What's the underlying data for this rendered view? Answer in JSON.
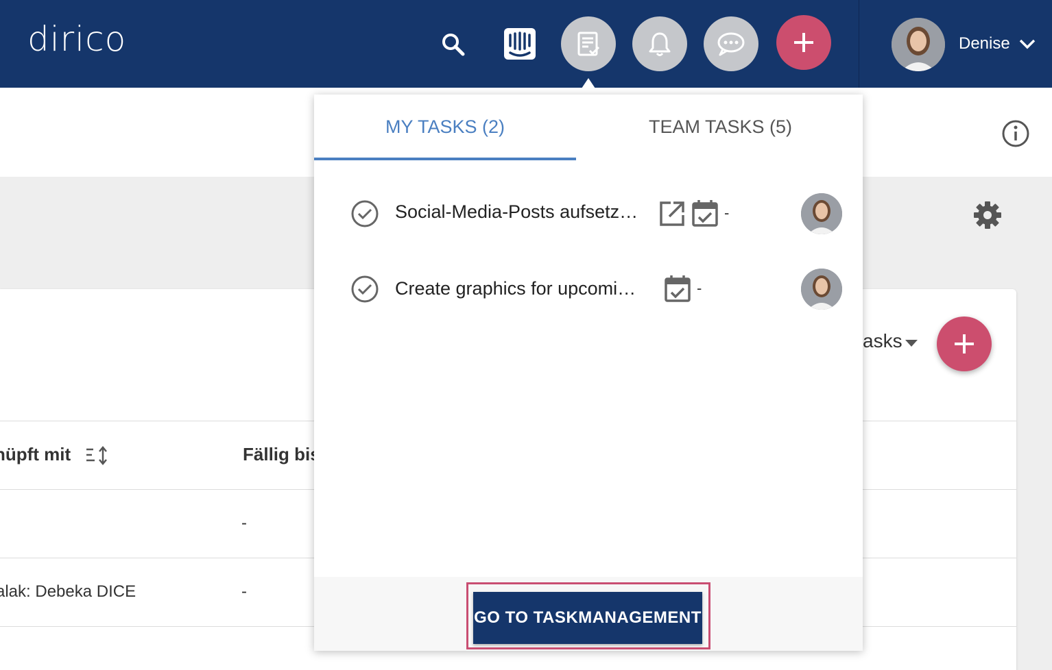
{
  "header": {
    "logo": "dirico",
    "user_name": "Denise",
    "icons": [
      "search-icon",
      "intercom-icon",
      "tasks-icon",
      "bell-icon",
      "chat-icon",
      "plus-icon",
      "chevron-down-icon"
    ]
  },
  "background": {
    "tasks_filter": "asks",
    "table": {
      "columns": [
        "nüpft mit",
        "Fällig bis"
      ],
      "rows": [
        {
          "linked": "",
          "due": "-"
        },
        {
          "linked": "alak: Debeka DICE",
          "due": "-"
        }
      ]
    }
  },
  "tasks_popover": {
    "tabs": [
      {
        "label": "MY TASKS (2)",
        "active": true
      },
      {
        "label": "TEAM TASKS (5)",
        "active": false
      }
    ],
    "tasks": [
      {
        "title": "Social-Media-Posts aufsetz…",
        "has_link": true,
        "due": "-"
      },
      {
        "title": "Create graphics for upcomi…",
        "has_link": false,
        "due": "-"
      }
    ],
    "footer_button": "GO TO TASKMANAGEMENT"
  },
  "colors": {
    "header_bg": "#15366b",
    "accent_pink": "#cc4e6e",
    "tab_active": "#4a7fc1",
    "icon_circle": "#c5c7cb"
  }
}
